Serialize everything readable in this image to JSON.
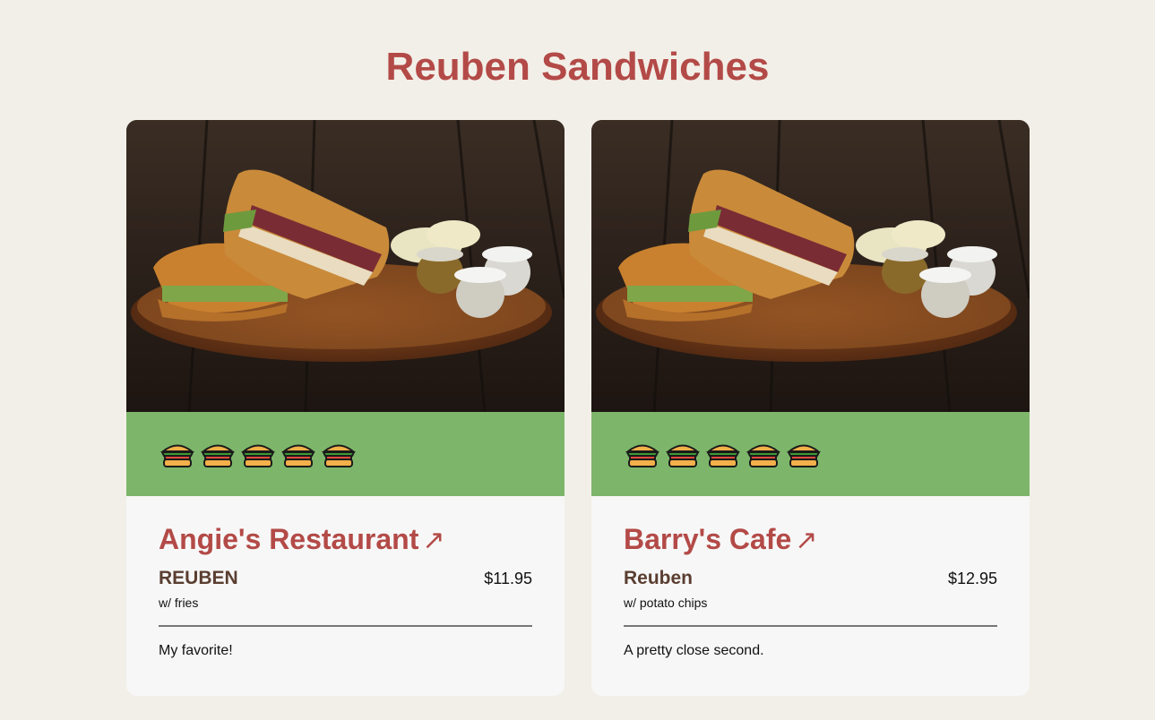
{
  "page": {
    "title": "Reuben Sandwiches"
  },
  "colors": {
    "background": "#f2efe8",
    "accent": "#b34a47",
    "rating_bar": "#7db66a",
    "item_name": "#5a3e30",
    "card": "#f7f7f7"
  },
  "cards": [
    {
      "restaurant": "Angie's Restaurant",
      "link_arrow": "↗",
      "photo_icon": "reuben-sandwich-photo",
      "rating": 5,
      "rating_icon": "sandwich-icon",
      "item_name": "REUBEN",
      "price": "$11.95",
      "side": "w/ fries",
      "note": "My favorite!"
    },
    {
      "restaurant": "Barry's Cafe",
      "link_arrow": "↗",
      "photo_icon": "reuben-sandwich-photo",
      "rating": 5,
      "rating_icon": "sandwich-icon",
      "item_name": "Reuben",
      "price": "$12.95",
      "side": "w/ potato chips",
      "note": "A pretty close second."
    }
  ]
}
